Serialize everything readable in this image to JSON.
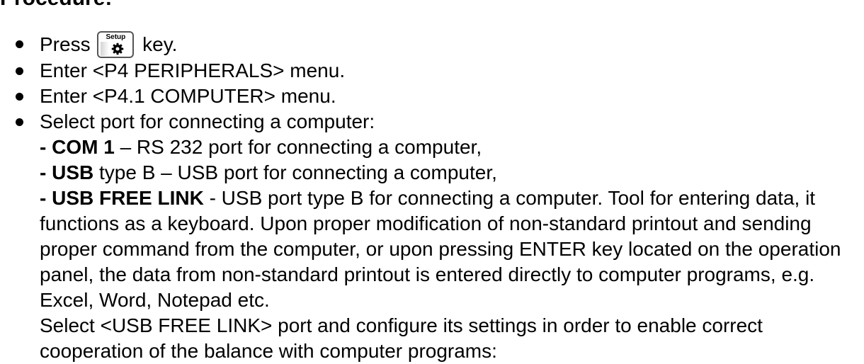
{
  "heading": "Procedure:",
  "setup_key": {
    "label": "Setup",
    "icon": "gear-icon"
  },
  "steps": {
    "press": {
      "before": "Press",
      "after": "key."
    },
    "enter_peripherals": "Enter <P4 PERIPHERALS> menu.",
    "enter_computer": "Enter <P4.1 COMPUTER> menu.",
    "select_port": {
      "intro": "Select port for connecting a computer:",
      "options": [
        {
          "dash": "- ",
          "name": "COM 1",
          "rest": " – RS 232 port for connecting a computer,"
        },
        {
          "dash": "- ",
          "name": "USB",
          "rest": " type B – USB port for connecting a computer,"
        },
        {
          "dash": "- ",
          "name": "USB FREE LINK",
          "rest": " - USB port type B for connecting a computer. Tool for entering data, it functions as a keyboard. Upon proper modification of non-standard printout and sending proper command from the computer, or upon pressing ENTER key located on the operation panel, the data from non-standard printout is entered directly to computer programs, e.g. Excel, Word, Notepad etc."
        }
      ],
      "note": "Select <USB FREE LINK> port and configure its settings in order to enable correct cooperation of the balance with computer programs:"
    }
  }
}
